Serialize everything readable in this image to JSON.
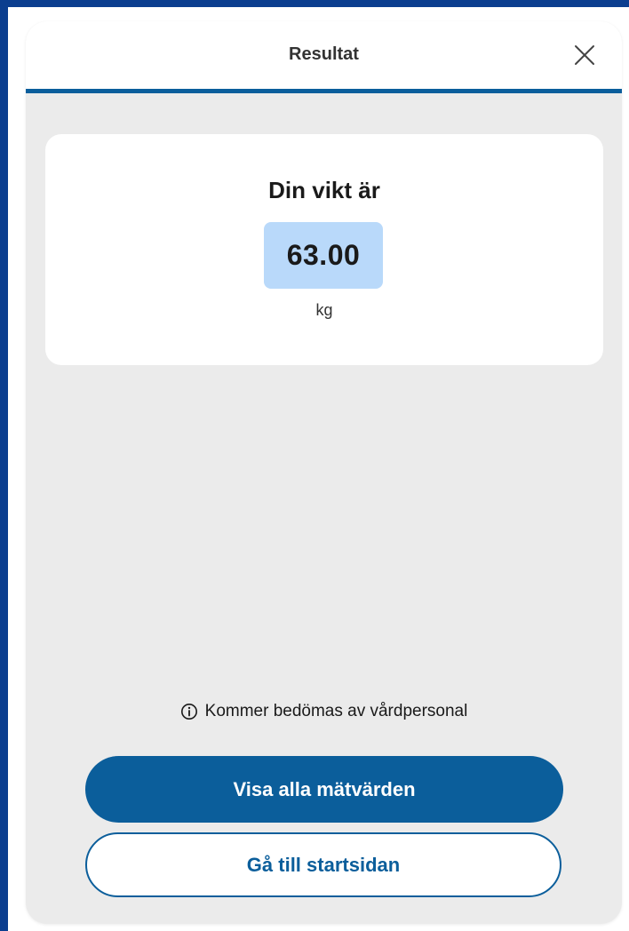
{
  "header": {
    "title": "Resultat",
    "close_icon": "close-icon"
  },
  "result": {
    "heading": "Din vikt är",
    "value": "63.00",
    "unit": "kg"
  },
  "info": {
    "icon": "info-icon",
    "text": "Kommer bedömas av vårdpersonal"
  },
  "actions": {
    "primary_label": "Visa alla mätvärden",
    "secondary_label": "Gå till startsidan"
  },
  "colors": {
    "accent": "#0b5e9b",
    "value_highlight": "#b9d9fa",
    "background": "#ebebeb",
    "frame": "#0b3e8f"
  }
}
